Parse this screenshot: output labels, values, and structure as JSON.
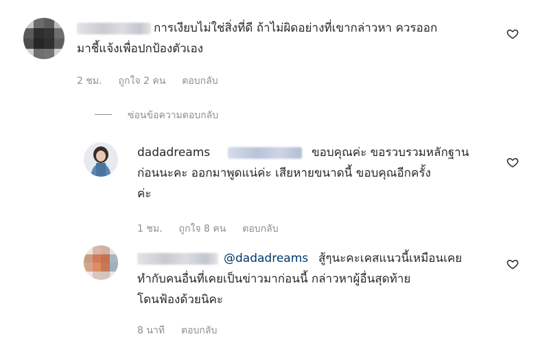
{
  "comments": [
    {
      "text_line1": "การเงียบไม่ใช่สิ่งที่ดี ถ้าไม่ผิดอย่างที่เขากล่าวหา ควรออก",
      "text_line2": "มาชี้แจ้งเพื่อปกป้องตัวเอง",
      "time": "2 ชม.",
      "likes": "ถูกใจ 2 คน",
      "reply": "ตอบกลับ"
    }
  ],
  "hide_replies_label": "ซ่อนข้อความตอบกลับ",
  "replies": [
    {
      "username": "dadadreams",
      "text_line1": "ขอบคุณค่ะ ขอรวบรวมหลักฐาน",
      "text_line2": "ก่อนนะคะ ออกมาพูดแน่ค่ะ เสียหายขนาดนี้ ขอบคุณอีกครั้ง",
      "text_line3": "ค่ะ",
      "time": "1 ชม.",
      "likes": "ถูกใจ 8 คน",
      "reply": "ตอบกลับ"
    },
    {
      "mention": "@dadadreams",
      "text_line1": "สู้ๆนะคะเคสแนวนี้เหมือนเคย",
      "text_line2": "ทำกับคนอื่นที่เคยเป็นข่าวมาก่อนนี้ กล่าวหาผู้อื่นสุดท้าย",
      "text_line3": "โดนฟ้องด้วยนิคะ",
      "time": "8 นาที",
      "reply": "ตอบกลับ"
    }
  ],
  "colors": {
    "text": "#262626",
    "meta": "#8e8e8e",
    "mention": "#00376b"
  },
  "icons": [
    "heart-outline-icon"
  ]
}
